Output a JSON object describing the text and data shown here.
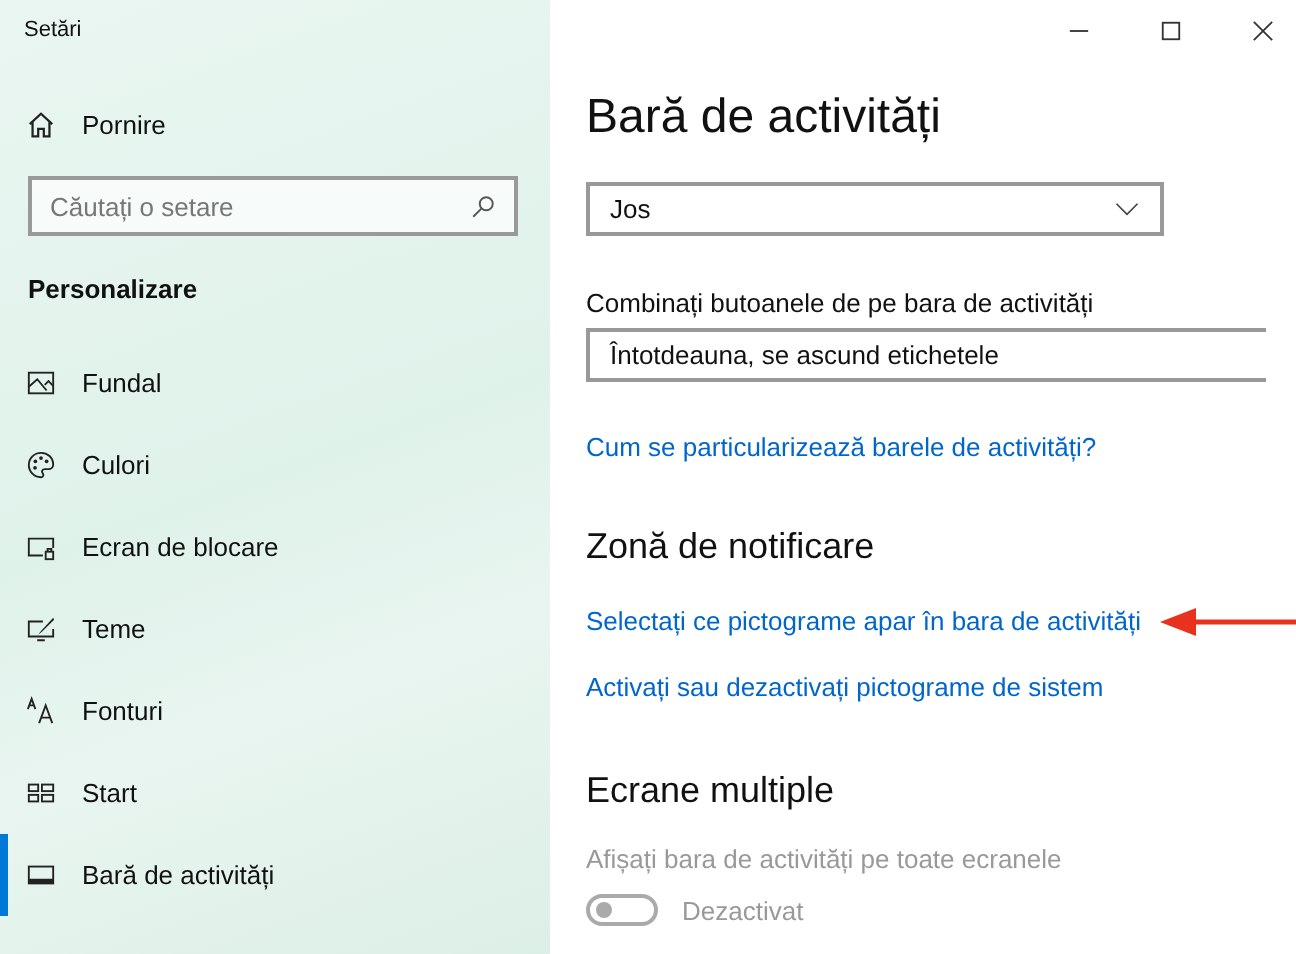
{
  "window": {
    "title": "Setări"
  },
  "sidebar": {
    "home": {
      "label": "Pornire"
    },
    "search": {
      "placeholder": "Căutați o setare"
    },
    "section": "Personalizare",
    "items": [
      {
        "label": "Fundal",
        "selected": false
      },
      {
        "label": "Culori",
        "selected": false
      },
      {
        "label": "Ecran de blocare",
        "selected": false
      },
      {
        "label": "Teme",
        "selected": false
      },
      {
        "label": "Fonturi",
        "selected": false
      },
      {
        "label": "Start",
        "selected": false
      },
      {
        "label": "Bară de activități",
        "selected": true
      }
    ]
  },
  "content": {
    "title": "Bară de activități",
    "location_dropdown": {
      "value": "Jos"
    },
    "combine": {
      "label": "Combinați butoanele de pe bara de activități",
      "value": "Întotdeauna, se ascund etichetele"
    },
    "help_link": "Cum se particularizează barele de activități?",
    "notification": {
      "heading": "Zonă de notificare",
      "links": [
        "Selectați ce pictograme apar în bara de activități",
        "Activați sau dezactivați pictograme de sistem"
      ]
    },
    "multiple": {
      "heading": "Ecrane multiple",
      "label": "Afișați bara de activități pe toate ecranele",
      "toggle": {
        "on": false,
        "disabled": true,
        "state_label": "Dezactivat"
      }
    }
  }
}
